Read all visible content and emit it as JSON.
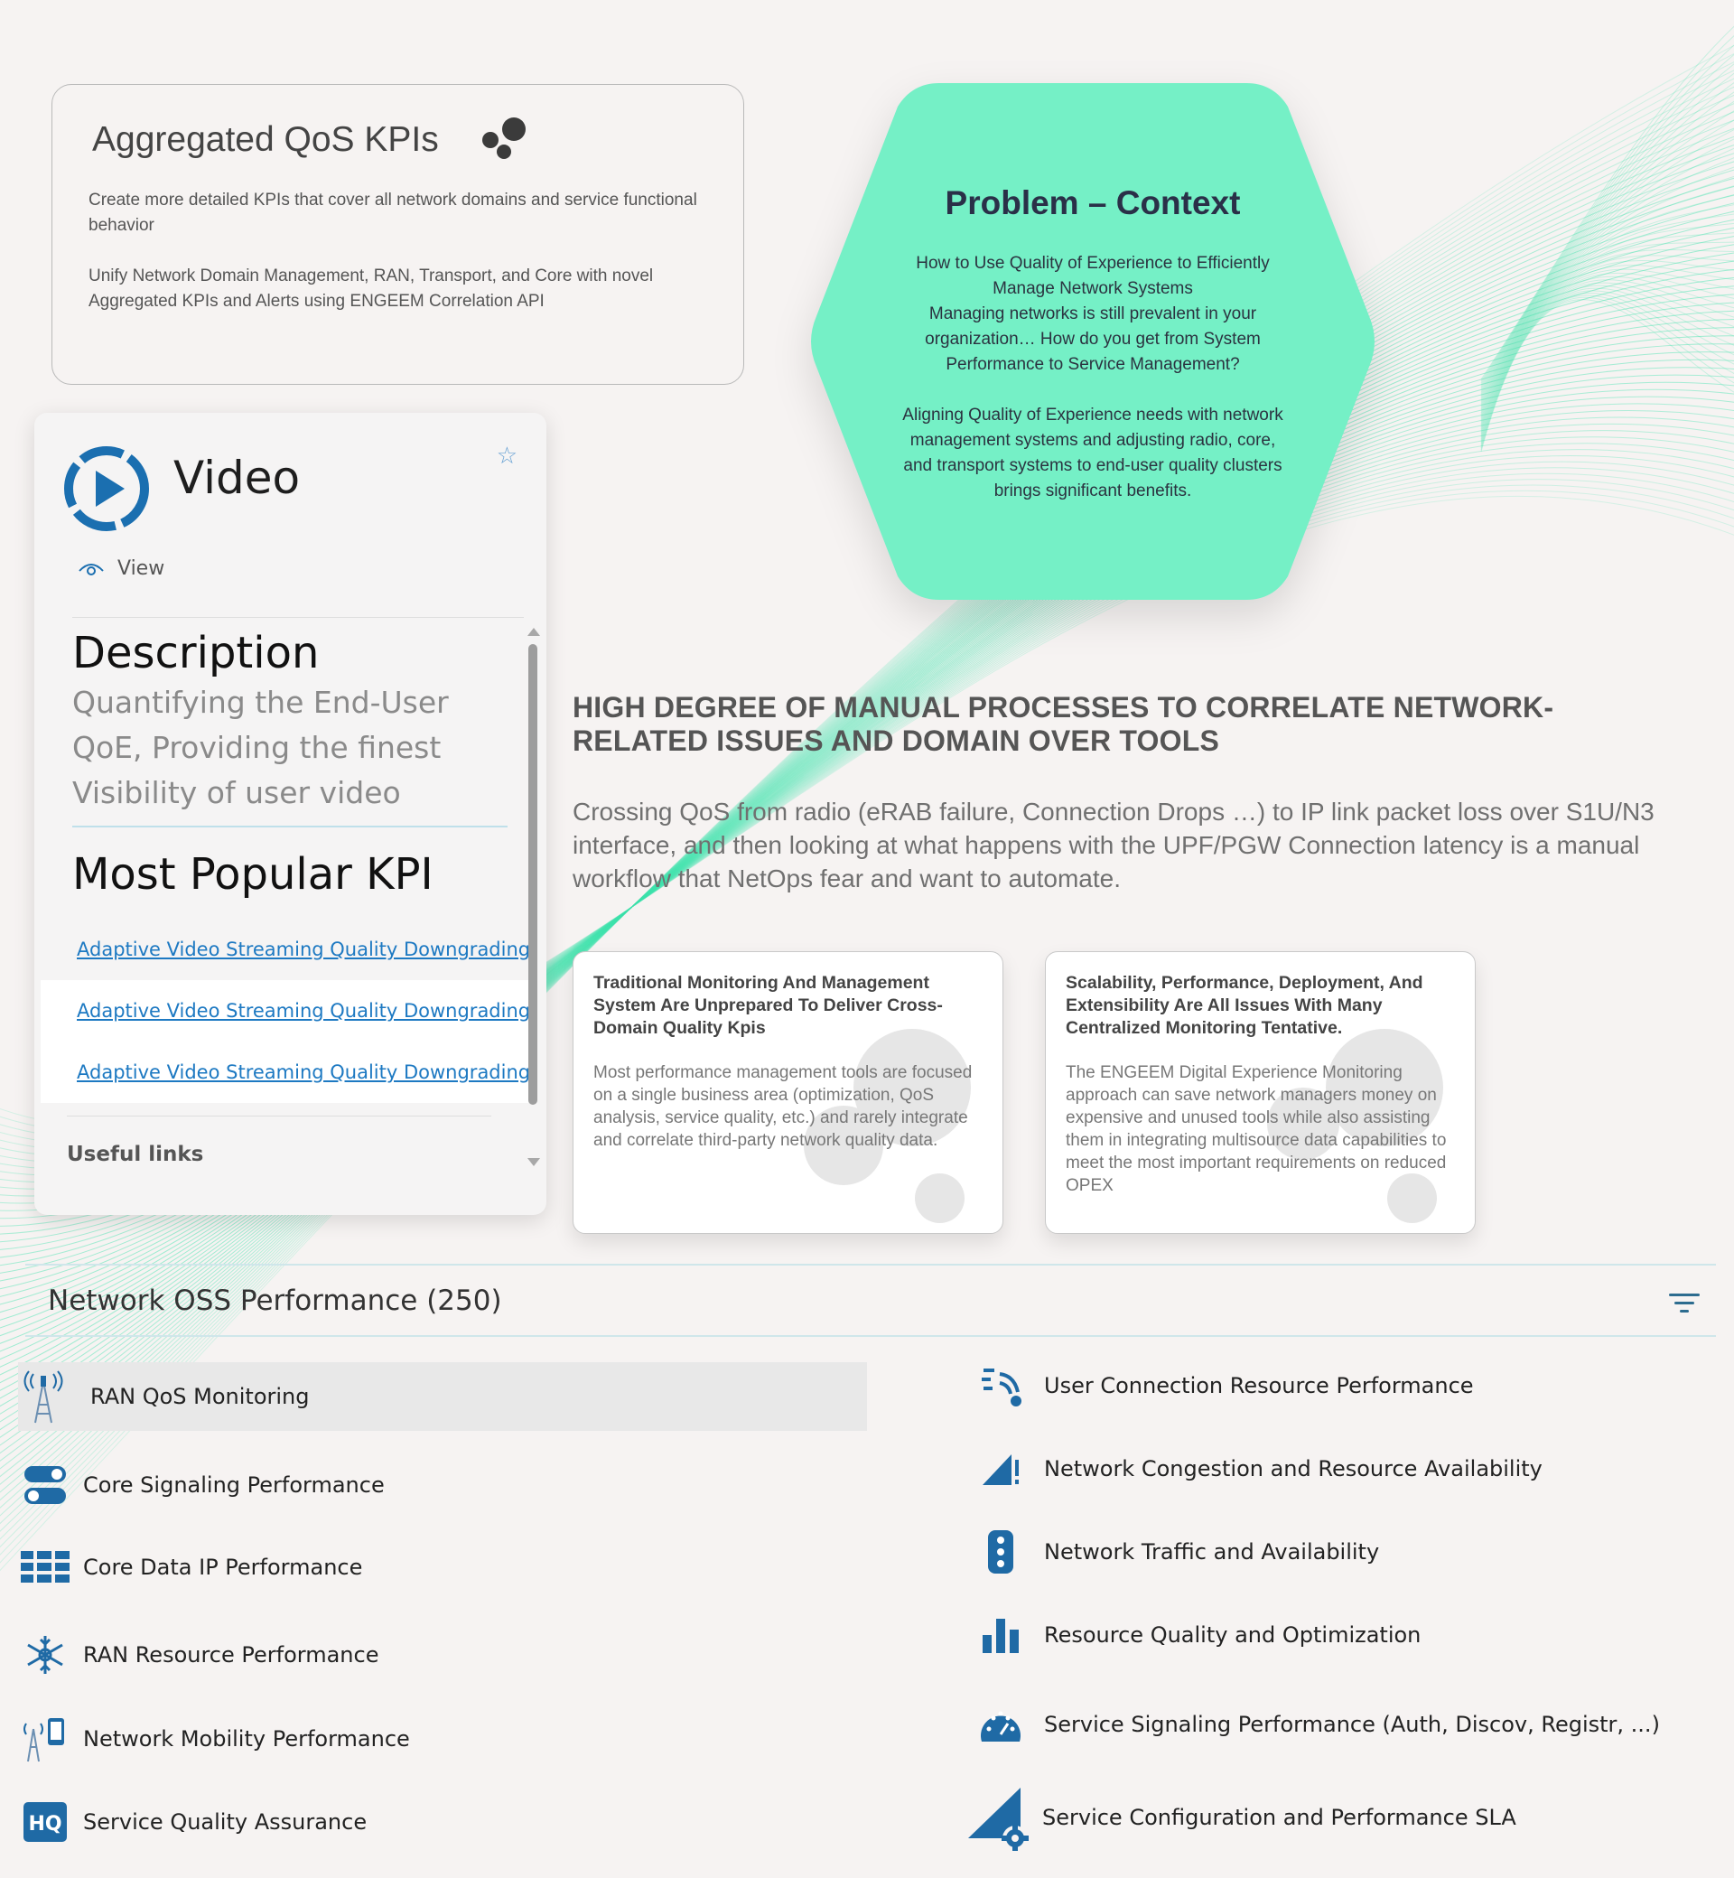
{
  "qos_card": {
    "title": "Aggregated QoS KPIs",
    "paragraph_1": "Create more detailed KPIs that cover all network domains and service functional behavior",
    "paragraph_2": "Unify Network Domain Management, RAN, Transport, and Core with novel Aggregated KPIs and Alerts using ENGEEM Correlation API",
    "icon": "bubbles-icon"
  },
  "problem_context": {
    "title": "Problem – Context",
    "paragraph_1": "How to Use Quality of Experience to Efficiently Manage Network Systems\nManaging networks is still prevalent in your organization… How do you get from System Performance to Service Management?",
    "paragraph_2": "Aligning Quality of Experience needs with network management systems and adjusting radio, core, and transport systems to end-user quality clusters brings significant benefits.",
    "color": "#75f0c6"
  },
  "video_panel": {
    "title": "Video",
    "view_label": "View",
    "description_title": "Description",
    "description_text": "Quantifying the End-User QoE, Providing the finest Visibility of user video",
    "popular_title": "Most Popular KPI",
    "links": [
      "Adaptive Video Streaming Quality Downgrading Rate",
      "Adaptive Video Streaming Quality Downgrading Rate",
      "Adaptive Video Streaming Quality Downgrading Rate"
    ],
    "useful_links": "Useful links",
    "accent": "#1b6fb0"
  },
  "manual": {
    "heading": "HIGH DEGREE OF MANUAL PROCESSES TO CORRELATE NETWORK-RELATED ISSUES AND DOMAIN OVER TOOLS",
    "text": "Crossing QoS from radio (eRAB failure, Connection Drops …) to IP link packet loss over S1U/N3 interface, and then looking at what happens with the UPF/PGW Connection latency is a manual workflow that NetOps fear and want to automate."
  },
  "cards": [
    {
      "title": "Traditional Monitoring And Management System Are Unprepared To Deliver Cross-Domain Quality Kpis",
      "text": "Most performance management tools are focused on a single business area (optimization, QoS analysis, service quality, etc.) and rarely integrate and correlate third-party network quality data."
    },
    {
      "title": "Scalability, Performance, Deployment, And Extensibility Are All Issues With Many Centralized Monitoring Tentative.",
      "text": "The ENGEEM Digital Experience Monitoring approach can save network managers money on expensive and unused tools while also assisting them in integrating multisource data capabilities to meet the most important requirements on reduced OPEX"
    }
  ],
  "oss": {
    "title": "Network OSS Performance (250)",
    "filter_icon": "filter-icon",
    "left_items": [
      {
        "label": "RAN QoS Monitoring",
        "icon": "antenna-tower-icon",
        "selected": true
      },
      {
        "label": "Core Signaling Performance",
        "icon": "toggle-switches-icon"
      },
      {
        "label": "Core Data IP Performance",
        "icon": "grid-list-icon"
      },
      {
        "label": "RAN Resource Performance",
        "icon": "snowflake-network-icon"
      },
      {
        "label": "Network Mobility Performance",
        "icon": "tower-phone-icon"
      },
      {
        "label": "Service Quality Assurance",
        "icon": "hq-badge-icon"
      }
    ],
    "right_items": [
      {
        "label": "User Connection Resource Performance",
        "icon": "wireless-user-icon"
      },
      {
        "label": "Network Congestion and Resource Availability",
        "icon": "signal-warning-icon"
      },
      {
        "label": "Network Traffic and Availability",
        "icon": "traffic-light-icon"
      },
      {
        "label": "Resource Quality and Optimization",
        "icon": "bar-chart-icon"
      },
      {
        "label": "Service Signaling Performance (Auth, Discov, Registr, ...)",
        "icon": "speedometer-icon"
      },
      {
        "label": "Service Configuration and Performance SLA",
        "icon": "signal-gear-icon"
      }
    ],
    "icon_color": "#1f6aa5"
  }
}
